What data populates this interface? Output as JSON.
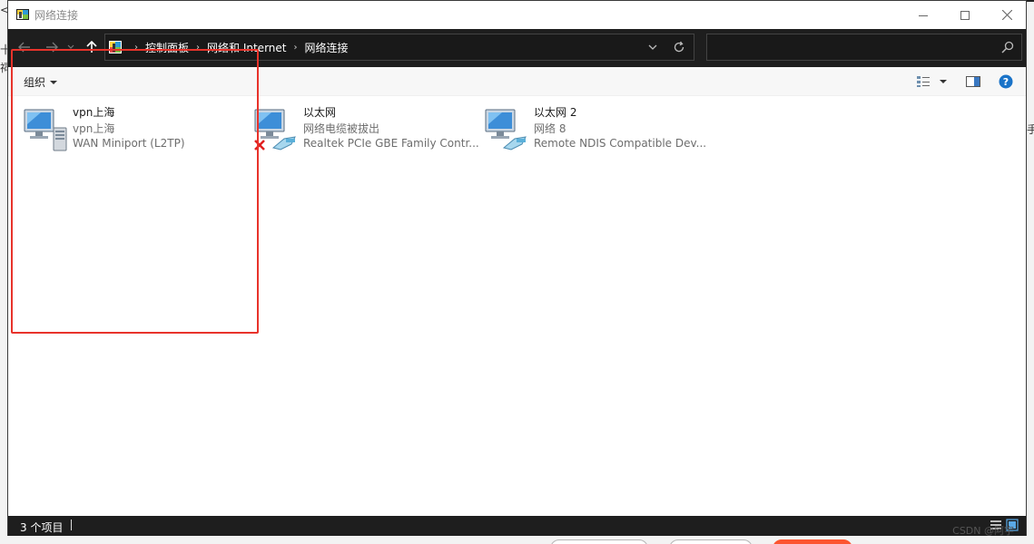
{
  "window": {
    "title": "网络连接"
  },
  "background": {
    "left_glyph_1": "<",
    "left_glyph_2": "十",
    "left_glyph_3": "祠",
    "right_glyph": "手"
  },
  "address": {
    "crumbs": [
      "控制面板",
      "网络和 Internet",
      "网络连接"
    ]
  },
  "search": {
    "placeholder": ""
  },
  "toolbar": {
    "organize_label": "组织"
  },
  "connections": [
    {
      "name": "vpn上海",
      "status": "vpn上海",
      "device": "WAN Miniport (L2TP)",
      "icon": "vpn-connection-icon"
    },
    {
      "name": "以太网",
      "status": "网络电缆被拔出",
      "device": "Realtek PCIe GBE Family Contr...",
      "icon": "ethernet-disconnected-icon"
    },
    {
      "name": "以太网 2",
      "status": "网络 8",
      "device": "Remote NDIS Compatible Dev...",
      "icon": "ethernet-connected-icon"
    }
  ],
  "statusbar": {
    "count_text": "3 个项目"
  },
  "watermark": "CSDN @阿宇",
  "colors": {
    "highlight": "#e8332b",
    "dark_bar": "#1e1e1e",
    "accent": "#0078d7"
  }
}
